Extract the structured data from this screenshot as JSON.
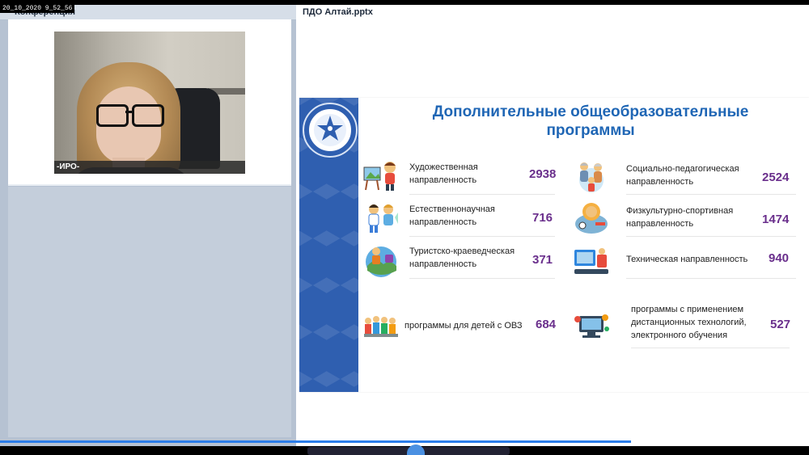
{
  "recording_stamp": "20_10_2020 9_52_56",
  "left_panel": {
    "title": "Конференция",
    "participant_name": "-ИРО-"
  },
  "right_panel": {
    "title": "ПДО Алтай.pptx"
  },
  "slide": {
    "title_line1": "Дополнительные общеобразовательные",
    "title_line2": "программы",
    "items": [
      {
        "label_line1": "Художественная",
        "label_line2": "направленность",
        "value": "2938",
        "icon": "painting-kids-icon"
      },
      {
        "label_line1": "Социально-педагогическая",
        "label_line2": "направленность",
        "value": "2524",
        "icon": "family-icon"
      },
      {
        "label_line1": "Естественнонаучная",
        "label_line2": "направленность",
        "value": "716",
        "icon": "science-kids-icon"
      },
      {
        "label_line1": "Физкультурно-спортивная",
        "label_line2": "направленность",
        "value": "1474",
        "icon": "sport-icon"
      },
      {
        "label_line1": "Туристско-краеведческая",
        "label_line2": "направленность",
        "value": "371",
        "icon": "tourism-icon"
      },
      {
        "label_line1": "Техническая  направленность",
        "label_line2": "",
        "value": "940",
        "icon": "technics-icon"
      },
      {
        "label_line1": "программы для детей с ОВЗ",
        "label_line2": "",
        "value": "684",
        "icon": "children-group-icon"
      },
      {
        "label_line1": "программы с применением",
        "label_line2": "дистанционных технологий,",
        "label_line3": "электронного обучения",
        "value": "527",
        "icon": "computer-icon"
      }
    ]
  },
  "colors": {
    "title_blue": "#1f66b5",
    "value_purple": "#6a2f8c",
    "strip_blue": "#2f5fb0"
  }
}
